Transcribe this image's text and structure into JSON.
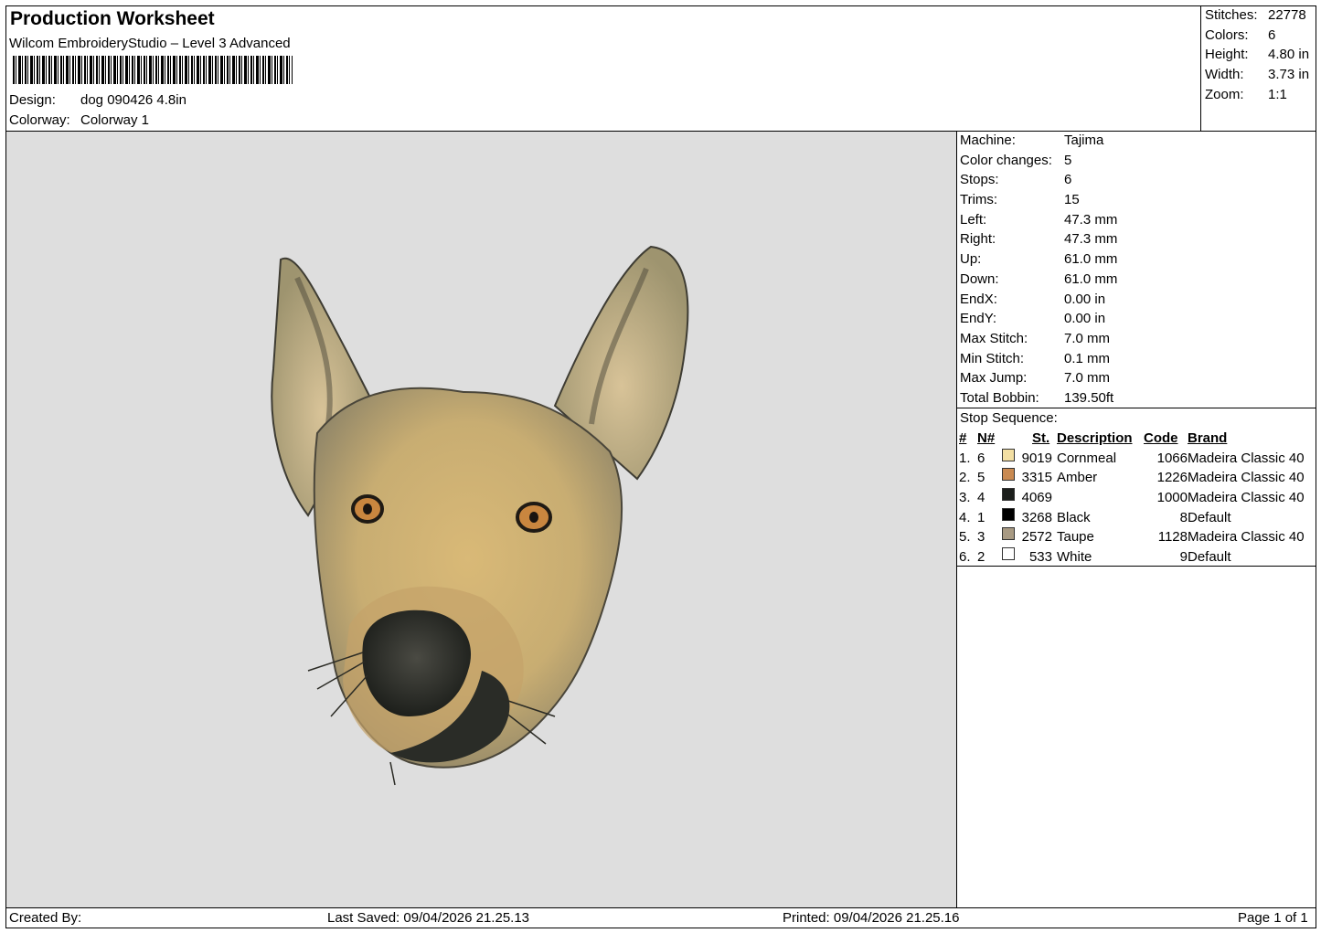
{
  "header": {
    "title": "Production Worksheet",
    "software": "Wilcom EmbroideryStudio – Level 3 Advanced",
    "design_label": "Design:",
    "design_value": "dog 090426 4.8in",
    "colorway_label": "Colorway:",
    "colorway_value": "Colorway 1"
  },
  "summary": [
    {
      "label": "Stitches:",
      "value": "22778"
    },
    {
      "label": "Colors:",
      "value": "6"
    },
    {
      "label": "Height:",
      "value": "4.80 in"
    },
    {
      "label": "Width:",
      "value": "3.73 in"
    },
    {
      "label": "Zoom:",
      "value": "1:1"
    }
  ],
  "machine_info": [
    {
      "label": "Machine:",
      "value": "Tajima"
    },
    {
      "label": "Color changes:",
      "value": "5"
    },
    {
      "label": "Stops:",
      "value": "6"
    },
    {
      "label": "Trims:",
      "value": "15"
    },
    {
      "label": "Left:",
      "value": "47.3 mm"
    },
    {
      "label": "Right:",
      "value": "47.3 mm"
    },
    {
      "label": "Up:",
      "value": "61.0 mm"
    },
    {
      "label": "Down:",
      "value": "61.0 mm"
    },
    {
      "label": "EndX:",
      "value": "0.00 in"
    },
    {
      "label": "EndY:",
      "value": "0.00 in"
    },
    {
      "label": "Max Stitch:",
      "value": "7.0 mm"
    },
    {
      "label": "Min Stitch:",
      "value": "0.1 mm"
    },
    {
      "label": "Max Jump:",
      "value": "7.0 mm"
    },
    {
      "label": "Total Bobbin:",
      "value": "139.50ft"
    }
  ],
  "stop_sequence": {
    "title": "Stop Sequence:",
    "columns": [
      "#",
      "N#",
      "St.",
      "Description",
      "Code",
      "Brand"
    ],
    "rows": [
      {
        "num": "1.",
        "n": "6",
        "color": "#f3dfa3",
        "st": "9019",
        "desc": "Cornmeal",
        "code": "1066",
        "brand": "Madeira Classic 40"
      },
      {
        "num": "2.",
        "n": "5",
        "color": "#c98a52",
        "st": "3315",
        "desc": "Amber",
        "code": "1226",
        "brand": "Madeira Classic 40"
      },
      {
        "num": "3.",
        "n": "4",
        "color": "#1c1f1c",
        "st": "4069",
        "desc": "",
        "code": "1000",
        "brand": "Madeira Classic 40"
      },
      {
        "num": "4.",
        "n": "1",
        "color": "#000000",
        "st": "3268",
        "desc": "Black",
        "code": "8",
        "brand": "Default"
      },
      {
        "num": "5.",
        "n": "3",
        "color": "#a89a83",
        "st": "2572",
        "desc": "Taupe",
        "code": "1128",
        "brand": "Madeira Classic 40"
      },
      {
        "num": "6.",
        "n": "2",
        "color": "#ffffff",
        "st": "533",
        "desc": "White",
        "code": "9",
        "brand": "Default"
      }
    ]
  },
  "footer": {
    "created_by": "Created By:",
    "last_saved": "Last Saved: 09/04/2026 21.25.13",
    "printed": "Printed: 09/04/2026 21.25.16",
    "page": "Page 1 of 1"
  }
}
